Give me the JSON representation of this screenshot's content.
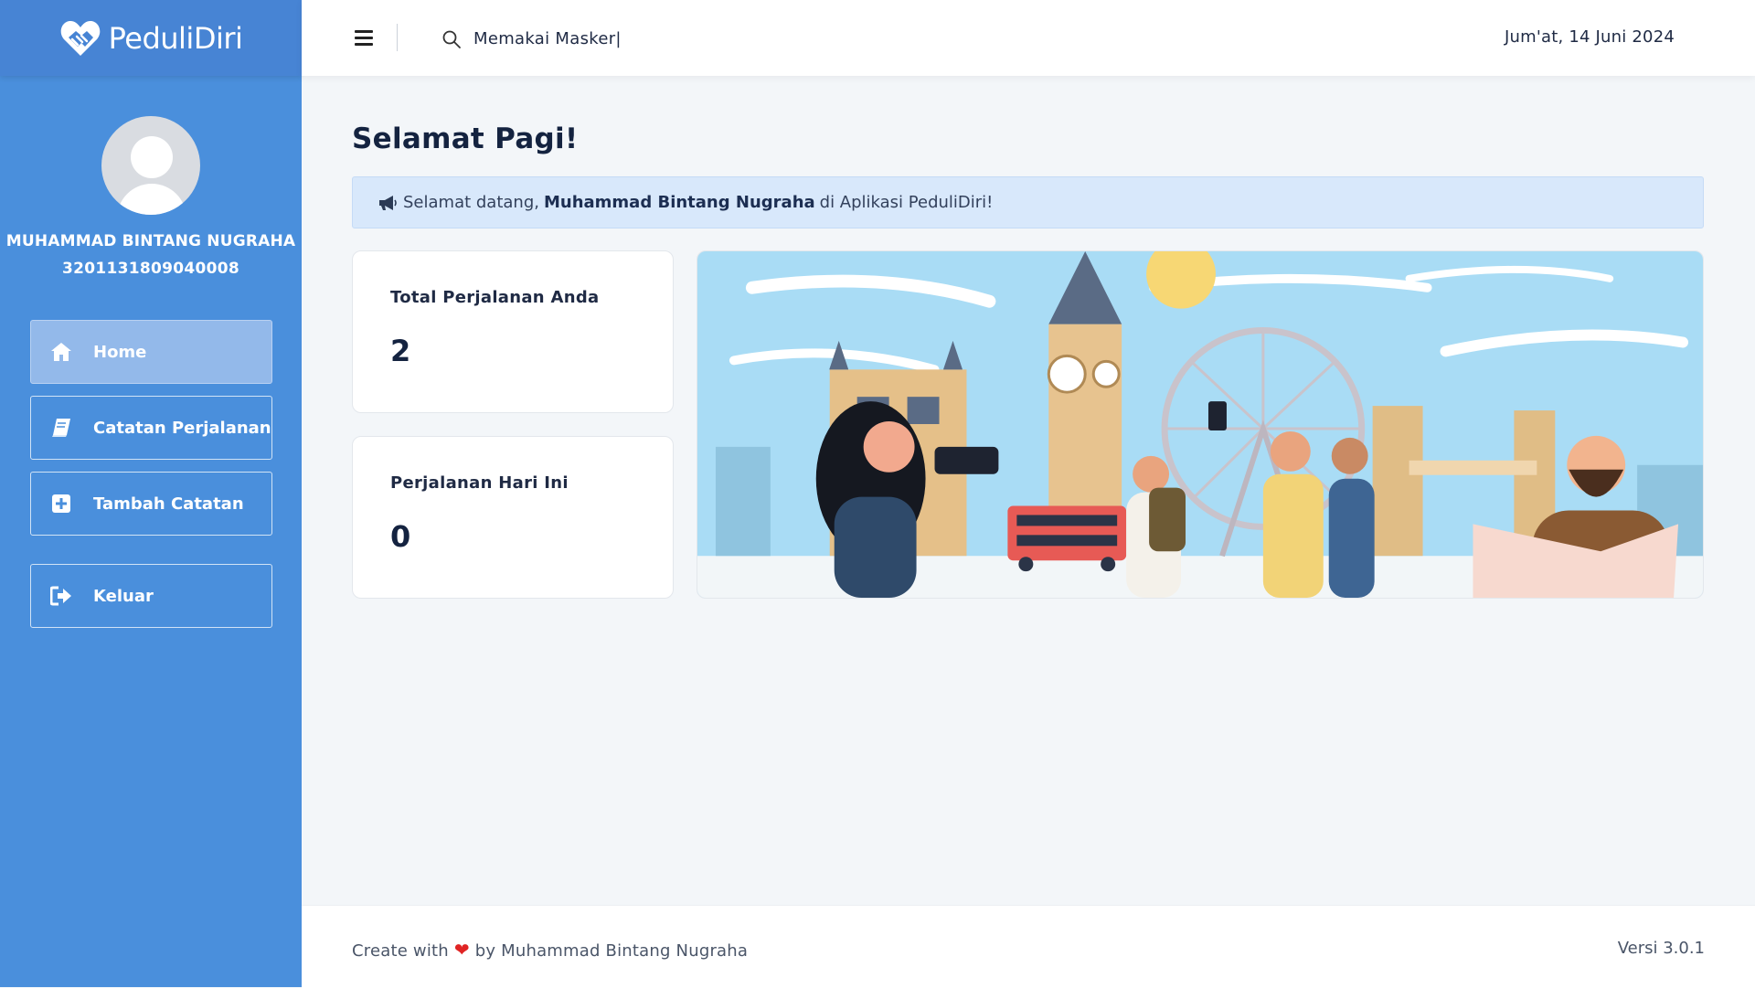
{
  "app": {
    "brand": "PeduliDiri"
  },
  "user": {
    "name": "MUHAMMAD BINTANG NUGRAHA",
    "nik": "3201131809040008"
  },
  "sidebar": {
    "items": [
      {
        "label": "Home",
        "icon": "home-icon"
      },
      {
        "label": "Catatan Perjalanan",
        "icon": "book-icon"
      },
      {
        "label": "Tambah Catatan",
        "icon": "plus-square-icon"
      },
      {
        "label": "Keluar",
        "icon": "sign-out-icon"
      }
    ]
  },
  "topbar": {
    "search_value": "Memakai Masker|",
    "date": "Jum'at, 14 Juni 2024"
  },
  "main": {
    "greeting": "Selamat Pagi!",
    "alert": {
      "prefix": "Selamat datang,",
      "name": "Muhammad Bintang Nugraha",
      "suffix": "di Aplikasi PeduliDiri!"
    },
    "cards": [
      {
        "label": "Total Perjalanan Anda",
        "value": "2"
      },
      {
        "label": "Perjalanan Hari Ini",
        "value": "0"
      }
    ]
  },
  "footer": {
    "prefix": "Create with",
    "suffix": "by Muhammad Bintang Nugraha",
    "version": "Versi 3.0.1"
  },
  "colors": {
    "sidebar": "#4a8fdc",
    "accent": "#93b9ea",
    "alert_bg": "#d8e8fb",
    "heart": "#e02424"
  }
}
